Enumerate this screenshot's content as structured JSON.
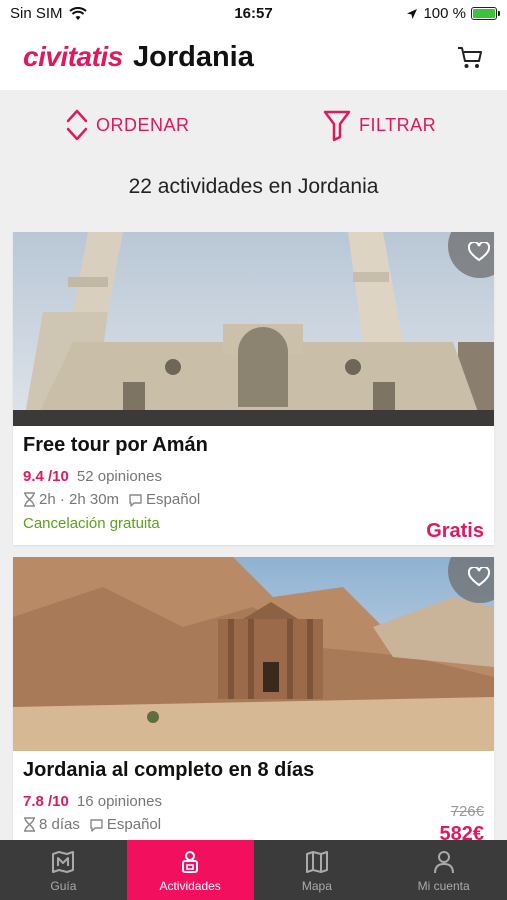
{
  "status_bar": {
    "carrier": "Sin SIM",
    "time": "16:57",
    "battery": "100 %",
    "battery_level": 1.0
  },
  "header": {
    "logo": "civitatis",
    "title": "Jordania"
  },
  "actions": {
    "sort_label": "ORDENAR",
    "filter_label": "FILTRAR"
  },
  "results_count": "22 actividades en Jordania",
  "activities": [
    {
      "title": "Free tour por Amán",
      "score": "9.4 /10",
      "reviews": "52 opiniones",
      "duration": "2h · 2h 30m",
      "language": "Español",
      "cancellation": "Cancelación gratuita",
      "price": "Gratis"
    },
    {
      "title": "Jordania al completo en 8 días",
      "score": "7.8 /10",
      "reviews": "16 opiniones",
      "duration": "8 días",
      "language": "Español",
      "old_price": "726€",
      "price": "582€"
    }
  ],
  "tabs": [
    {
      "label": "Guía",
      "icon": "map-guide-icon"
    },
    {
      "label": "Actividades",
      "icon": "activities-icon",
      "active": true
    },
    {
      "label": "Mapa",
      "icon": "map-icon"
    },
    {
      "label": "Mi cuenta",
      "icon": "user-icon"
    }
  ],
  "colors": {
    "brand": "#e1185a",
    "active_tab": "#f2105e",
    "green": "#5aa21a",
    "tabbar": "#3b3b3b"
  }
}
